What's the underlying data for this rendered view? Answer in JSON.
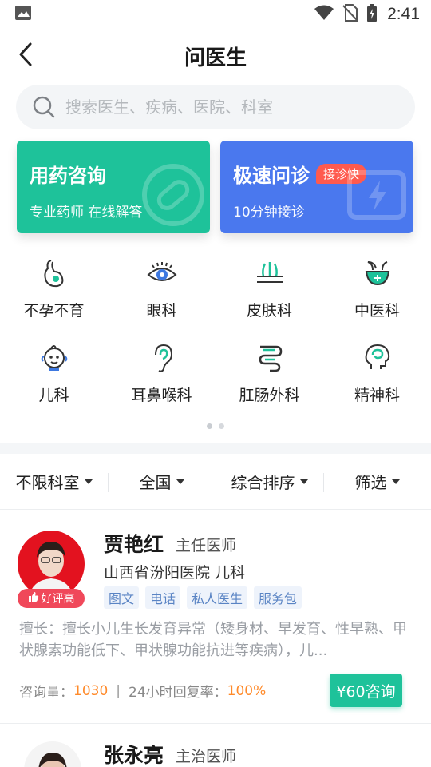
{
  "status": {
    "time": "2:41",
    "icons": [
      "image-icon",
      "wifi-icon",
      "no-sim-icon",
      "battery-charging-icon"
    ]
  },
  "header": {
    "title": "问医生"
  },
  "search": {
    "placeholder": "搜索医生、疾病、医院、科室"
  },
  "cards": [
    {
      "title": "用药咨询",
      "subtitle": "专业药师  在线解答",
      "color": "#1ec29a",
      "icon": "pill-icon"
    },
    {
      "title": "极速问诊",
      "badge": "接诊快",
      "subtitle": "10分钟接诊",
      "color": "#4a78ee",
      "icon": "lightning-icon"
    }
  ],
  "departments": [
    {
      "label": "不孕不育",
      "icon": "pregnancy-icon"
    },
    {
      "label": "眼科",
      "icon": "eye-icon"
    },
    {
      "label": "皮肤科",
      "icon": "skin-icon"
    },
    {
      "label": "中医科",
      "icon": "herbal-mortar-icon"
    },
    {
      "label": "儿科",
      "icon": "baby-icon"
    },
    {
      "label": "耳鼻喉科",
      "icon": "ear-icon"
    },
    {
      "label": "肛肠外科",
      "icon": "intestine-icon"
    },
    {
      "label": "精神科",
      "icon": "brain-head-icon"
    }
  ],
  "pager": {
    "pages": 2,
    "active": 0
  },
  "filters": [
    {
      "label": "不限科室"
    },
    {
      "label": "全国"
    },
    {
      "label": "综合排序"
    },
    {
      "label": "筛选"
    }
  ],
  "doctors": [
    {
      "name": "贾艳红",
      "title": "主任医师",
      "hospital": "山西省汾阳医院  儿科",
      "badge": "好评高",
      "tags": [
        "图文",
        "电话",
        "私人医生",
        "服务包"
      ],
      "desc": "擅长：擅长小儿生长发育异常（矮身材、早发育、性早熟、甲状腺素功能低下、甲状腺功能抗进等疾病），儿...",
      "stats": {
        "consult_label": "咨询量：",
        "consult_value": "1030",
        "reply_label": "24小时回复率：",
        "reply_value": "100%"
      },
      "price_button": "¥60咨询"
    },
    {
      "name": "张永亮",
      "title": "主治医师"
    }
  ],
  "colors": {
    "accent_green": "#1ec29a",
    "accent_blue": "#4a78ee",
    "badge_red": "#f0485a",
    "stat_orange": "#ff8a2a"
  }
}
